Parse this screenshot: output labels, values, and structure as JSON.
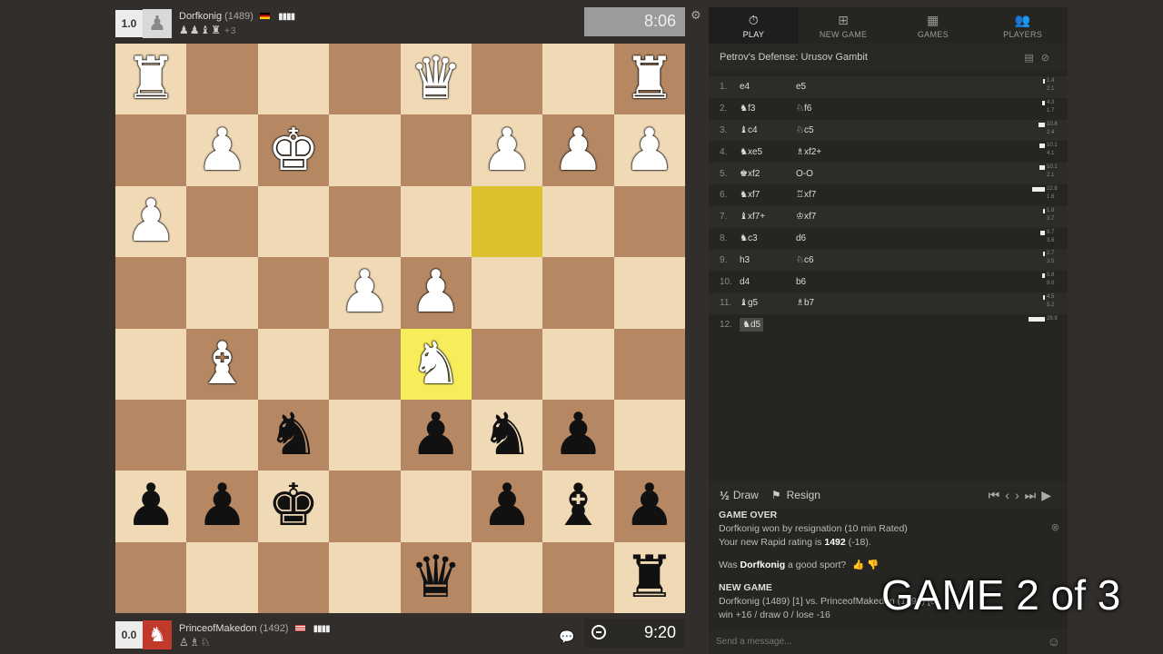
{
  "top_player": {
    "score": "1.0",
    "name": "Dorfkonig",
    "rating": "(1489)",
    "captured": "♟♟♝♜",
    "captured_extra": "+3",
    "clock": "8:06"
  },
  "bottom_player": {
    "score": "0.0",
    "name": "PrinceofMakedon",
    "rating": "(1492)",
    "captured": "♙♗♘",
    "clock": "9:20"
  },
  "board": [
    [
      "wR",
      "",
      "",
      "",
      "wQ",
      "",
      "",
      "wR"
    ],
    [
      "",
      "wP",
      "wK",
      "",
      "",
      "wP",
      "wP",
      "wP"
    ],
    [
      "wP",
      "",
      "",
      "",
      "",
      "",
      "",
      ""
    ],
    [
      "",
      "",
      "",
      "wP",
      "wP",
      "",
      "",
      ""
    ],
    [
      "",
      "wB",
      "",
      "",
      "wN",
      "",
      "",
      ""
    ],
    [
      "",
      "",
      "bN",
      "",
      "bP",
      "bN",
      "bP",
      ""
    ],
    [
      "bP",
      "bP",
      "bK",
      "",
      "",
      "bP",
      "bB",
      "bP"
    ],
    [
      "",
      "",
      "",
      "",
      "bQ",
      "",
      "",
      "bR"
    ]
  ],
  "highlights": {
    "from": [
      2,
      5
    ],
    "to": [
      4,
      4
    ]
  },
  "tabs": [
    {
      "label": "PLAY",
      "icon": "stopwatch-icon"
    },
    {
      "label": "NEW GAME",
      "icon": "plus-icon"
    },
    {
      "label": "GAMES",
      "icon": "board-icon"
    },
    {
      "label": "PLAYERS",
      "icon": "people-icon"
    }
  ],
  "opening": "Petrov's Defense: Urusov Gambit",
  "moves": [
    {
      "n": "1.",
      "w": "e4",
      "b": "e5",
      "e1": "1.4",
      "e2": "2.1",
      "bw": 2
    },
    {
      "n": "2.",
      "w": "♞f3",
      "b": "♘f6",
      "e1": "4.3",
      "e2": "1.7",
      "bw": 3
    },
    {
      "n": "3.",
      "w": "♝c4",
      "b": "♘c5",
      "e1": "10.8",
      "e2": "2.4",
      "bw": 7
    },
    {
      "n": "4.",
      "w": "♞xe5",
      "b": "♗xf2+",
      "e1": "10.1",
      "e2": "4.1",
      "bw": 6
    },
    {
      "n": "5.",
      "w": "♚xf2",
      "b": "O-O",
      "e1": "10.1",
      "e2": "2.1",
      "bw": 6
    },
    {
      "n": "6.",
      "w": "♞xf7",
      "b": "♖xf7",
      "e1": "22.8",
      "e2": "1.6",
      "bw": 14
    },
    {
      "n": "7.",
      "w": "♝xf7+",
      "b": "♔xf7",
      "e1": "1.8",
      "e2": "3.7",
      "bw": 2
    },
    {
      "n": "8.",
      "w": "♞c3",
      "b": "d6",
      "e1": "9.7",
      "e2": "3.6",
      "bw": 5
    },
    {
      "n": "9.",
      "w": "h3",
      "b": "♘c6",
      "e1": "2.7",
      "e2": "3.5",
      "bw": 2
    },
    {
      "n": "10.",
      "w": "d4",
      "b": "b6",
      "e1": "5.8",
      "e2": "9.0",
      "bw": 3
    },
    {
      "n": "11.",
      "w": "♝g5",
      "b": "♗b7",
      "e1": "4.5",
      "e2": "5.2",
      "bw": 2
    },
    {
      "n": "12.",
      "w": "♞d5",
      "b": "",
      "e1": "29.9",
      "e2": "",
      "bw": 18
    }
  ],
  "controls": {
    "draw": "Draw",
    "resign": "Resign",
    "half": "½"
  },
  "gameover": {
    "title": "GAME OVER",
    "line1_name": "Dorfkonig",
    "line1_rest": "won by resignation (10 min Rated)",
    "line2_pre": "Your new Rapid rating is",
    "line2_rating": "1492",
    "line2_post": "(-18).",
    "sport_pre": "Was",
    "sport_name": "Dorfkonig",
    "sport_post": "a good sport?",
    "newgame_title": "NEW GAME",
    "newgame_line": "Dorfkonig (1489) [1] vs. PrinceofMakedon (1492) [0]",
    "stats": "win +16 / draw 0 / lose -16"
  },
  "message_placeholder": "Send a message...",
  "overlay_text": "GAME 2 of 3"
}
